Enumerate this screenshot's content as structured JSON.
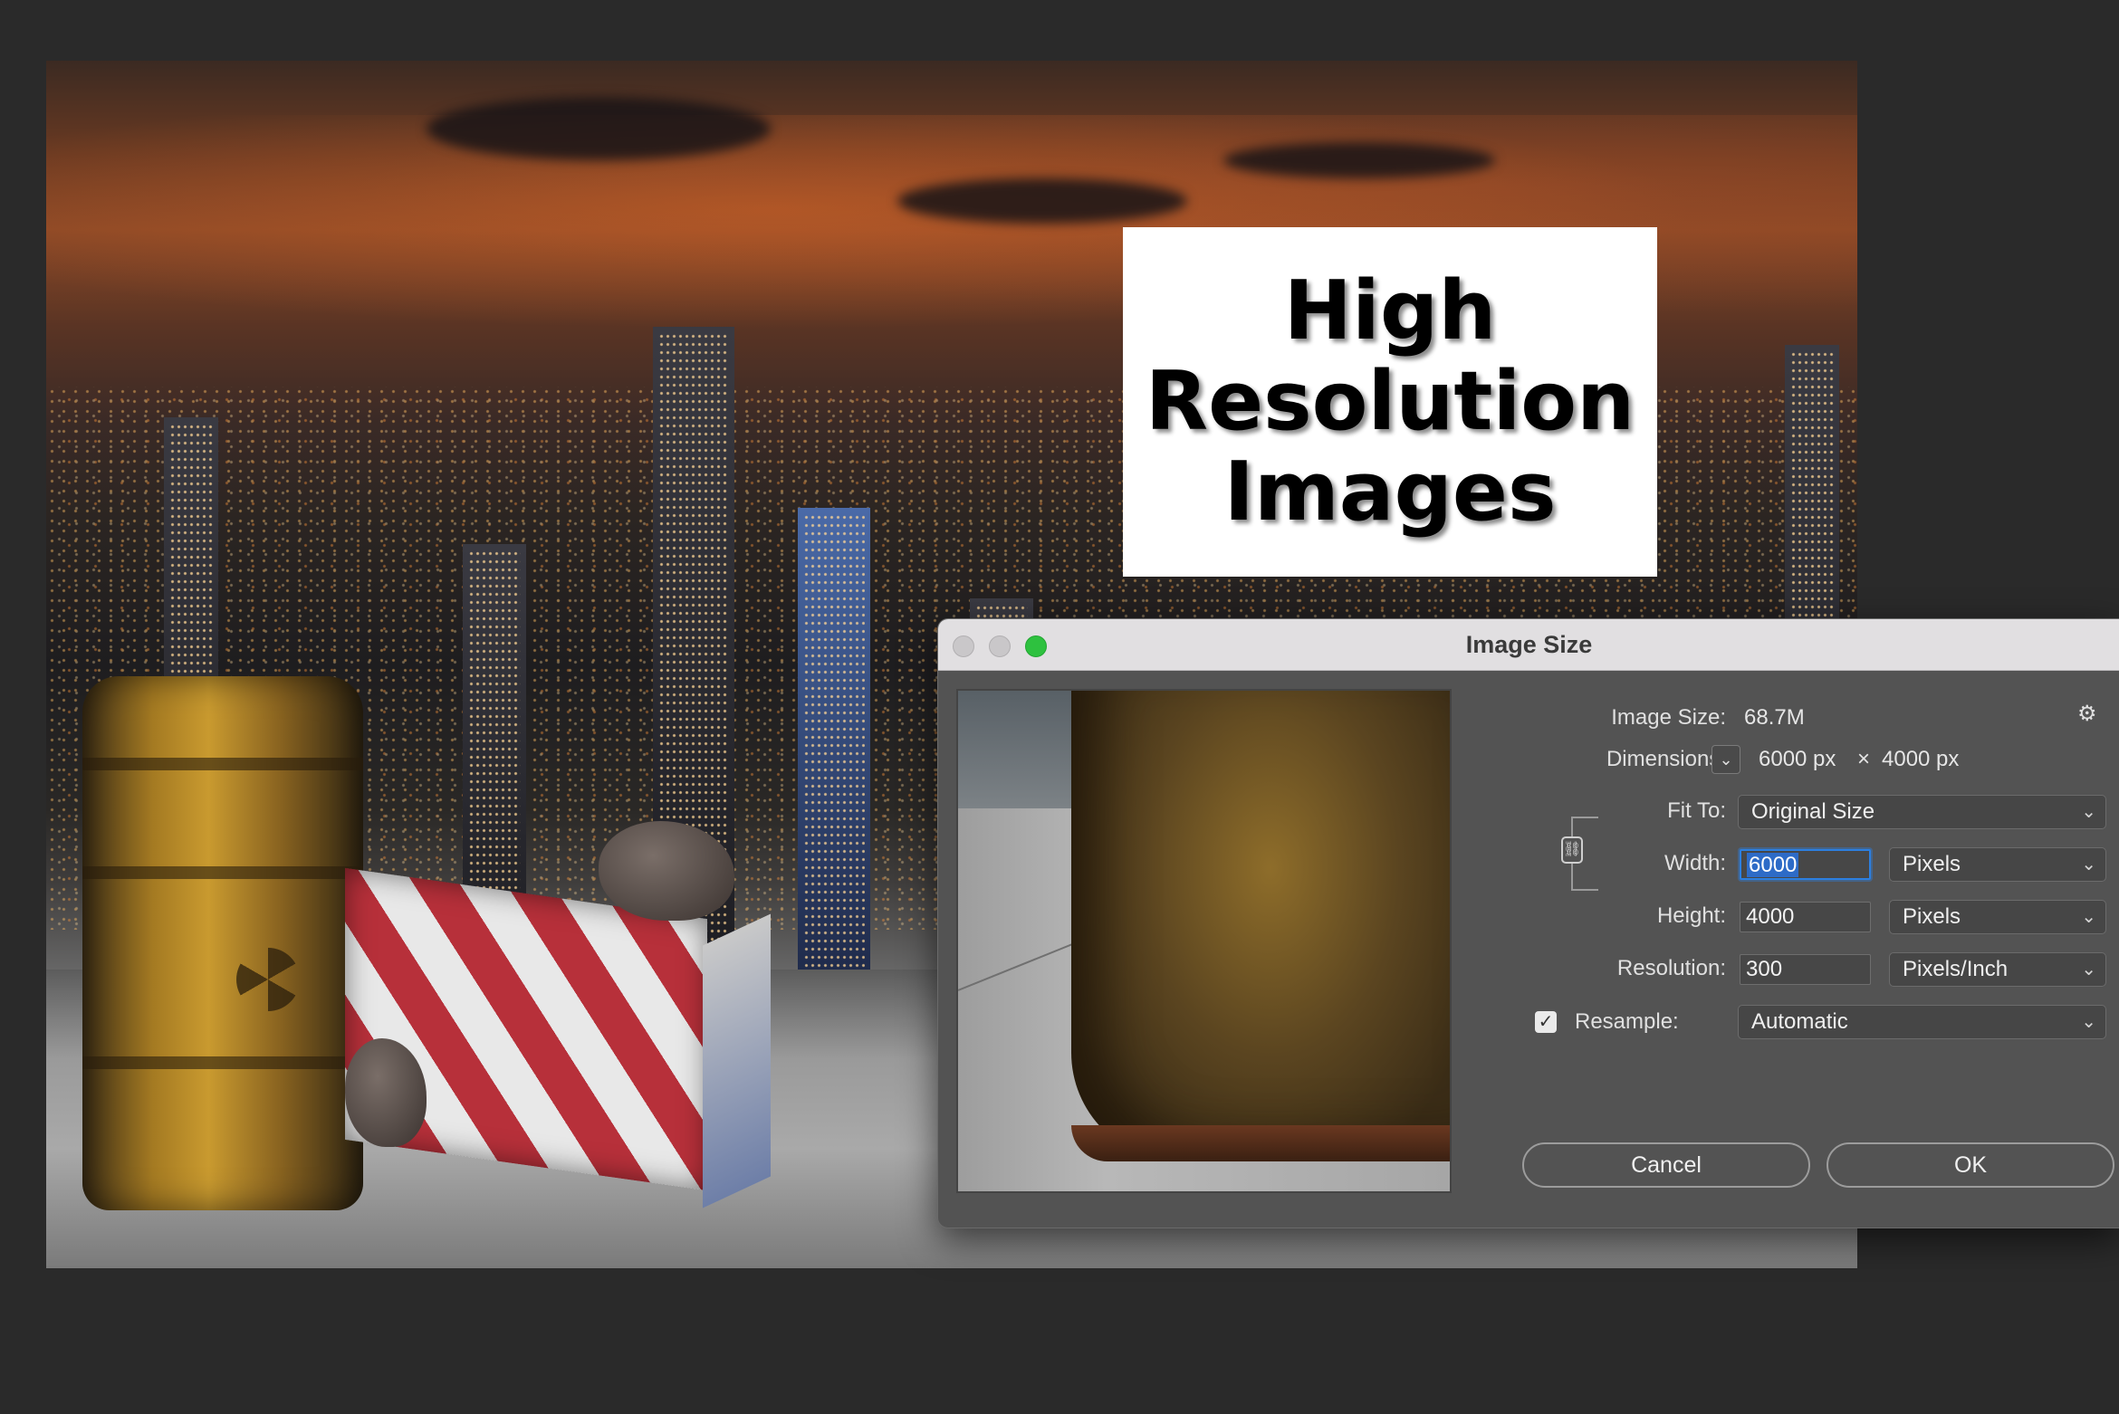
{
  "overlay": {
    "lines": [
      "High",
      "Resolution",
      "Images"
    ]
  },
  "dialog": {
    "title": "Image Size",
    "image_size_label": "Image Size:",
    "image_size_value": "68.7M",
    "dimensions_label": "Dimensions:",
    "dimensions_width": "6000 px",
    "dimensions_times": "×",
    "dimensions_height": "4000 px",
    "fit_to_label": "Fit To:",
    "fit_to_value": "Original Size",
    "width_label": "Width:",
    "width_value": "6000",
    "width_unit": "Pixels",
    "height_label": "Height:",
    "height_value": "4000",
    "height_unit": "Pixels",
    "resolution_label": "Resolution:",
    "resolution_value": "300",
    "resolution_unit": "Pixels/Inch",
    "resample_label": "Resample:",
    "resample_checked": true,
    "resample_value": "Automatic",
    "cancel_label": "Cancel",
    "ok_label": "OK"
  },
  "icons": {
    "gear": "⚙",
    "chevron": "⌄",
    "check": "✓",
    "link": "⛓"
  }
}
